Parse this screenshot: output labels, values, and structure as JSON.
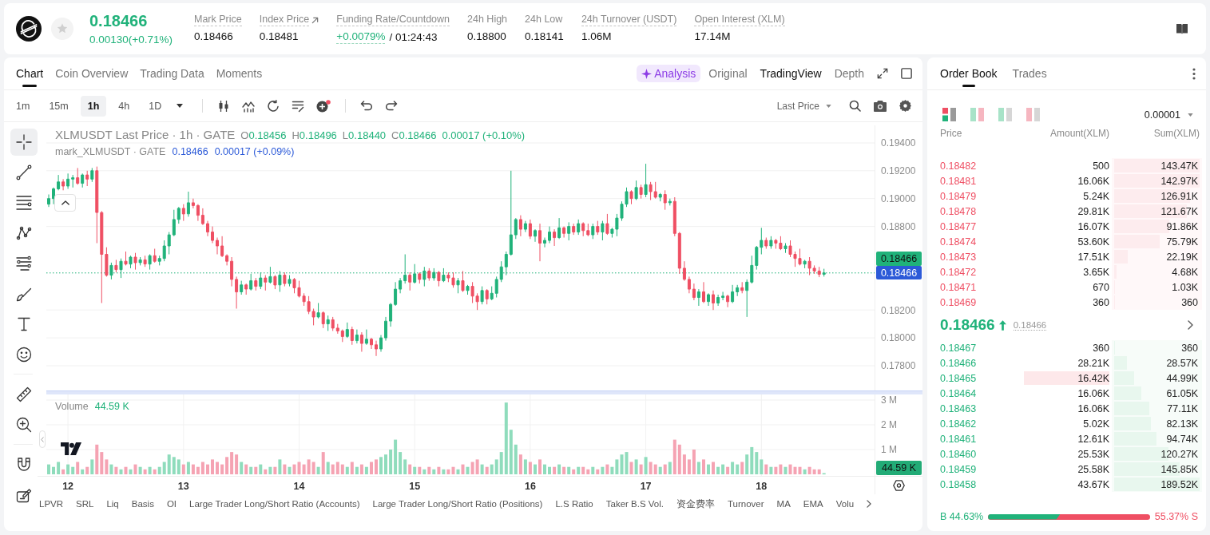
{
  "header": {
    "price": "0.18466",
    "change": "0.00130(+0.71%)",
    "stats": [
      {
        "kind": "plain",
        "label": "Mark Price",
        "value": "0.18466",
        "dotted": true
      },
      {
        "kind": "link",
        "label": "Index Price",
        "value": "0.18481",
        "dotted": true
      },
      {
        "kind": "funding",
        "label": "Funding Rate/Countdown",
        "value": "+0.0079%",
        "countdown": "/ 01:24:43",
        "dotted": true
      },
      {
        "kind": "plain",
        "label": "24h High",
        "value": "0.18800",
        "dotted": false
      },
      {
        "kind": "plain",
        "label": "24h Low",
        "value": "0.18141",
        "dotted": false
      },
      {
        "kind": "plain",
        "label": "24h Turnover (USDT)",
        "value": "1.06M",
        "dotted": true
      },
      {
        "kind": "plain",
        "label": "Open Interest (XLM)",
        "value": "17.14M",
        "dotted": true
      }
    ]
  },
  "chart_panel": {
    "tabs": [
      {
        "label": "Chart",
        "selected": true
      },
      {
        "label": "Coin Overview",
        "selected": false
      },
      {
        "label": "Trading Data",
        "selected": false
      },
      {
        "label": "Moments",
        "selected": false
      }
    ],
    "analysis": "Analysis",
    "views": [
      {
        "label": "Original",
        "selected": false
      },
      {
        "label": "TradingView",
        "selected": true
      },
      {
        "label": "Depth",
        "selected": false
      }
    ],
    "intervals": [
      {
        "label": "1m",
        "selected": false
      },
      {
        "label": "15m",
        "selected": false
      },
      {
        "label": "1h",
        "selected": true
      },
      {
        "label": "4h",
        "selected": false
      },
      {
        "label": "1D",
        "selected": false
      }
    ],
    "price_source": "Last Price",
    "tool_groups": [
      [
        {
          "kind": "crosshair",
          "selected": true
        },
        {
          "kind": "trend_line",
          "selected": false
        },
        {
          "kind": "fib_lines",
          "selected": false
        },
        {
          "kind": "pattern",
          "selected": false
        },
        {
          "kind": "parallel_lines",
          "selected": false
        },
        {
          "kind": "brush",
          "selected": false
        },
        {
          "kind": "text",
          "selected": false
        },
        {
          "kind": "emoji",
          "selected": false
        }
      ],
      [
        {
          "kind": "ruler",
          "selected": false
        },
        {
          "kind": "zoom",
          "selected": false
        }
      ],
      [
        {
          "kind": "magnet",
          "selected": false
        },
        {
          "kind": "drawing_edit",
          "selected": false
        }
      ]
    ],
    "legend": {
      "title": "XLMUSDT Last Price · 1h · GATE",
      "ohlc": [
        {
          "key": "O",
          "value": "0.18456"
        },
        {
          "key": "H",
          "value": "0.18496"
        },
        {
          "key": "L",
          "value": "0.18440"
        },
        {
          "key": "C",
          "value": "0.18466"
        }
      ],
      "change": "0.00017 (+0.10%)"
    },
    "mark_legend": {
      "title": "mark_XLMUSDT · GATE",
      "value": "0.18466",
      "change": "0.00017 (+0.09%)"
    },
    "chart_data": {
      "type": "candlestick",
      "grid": true,
      "categories": [
        null,
        null,
        null,
        null,
        null,
        null,
        null,
        null,
        null,
        null,
        null,
        null,
        null,
        null,
        null,
        null,
        null,
        null,
        null,
        null,
        null,
        null,
        null,
        null,
        null,
        null,
        null,
        null,
        null,
        null,
        null,
        null,
        null,
        null,
        null,
        null,
        null,
        null,
        null,
        null,
        null,
        null,
        null,
        null,
        null,
        null,
        null,
        null,
        null,
        null,
        null,
        null,
        null,
        null,
        null,
        null,
        null,
        null,
        null,
        null,
        null,
        null,
        null,
        null,
        null,
        null,
        null,
        null,
        null,
        null,
        null,
        null,
        null,
        null,
        null,
        null,
        null,
        null,
        null,
        null,
        null,
        null,
        null,
        null,
        null,
        null,
        null,
        null,
        null,
        null,
        null,
        null,
        null,
        null,
        null,
        null,
        null,
        null,
        null,
        null,
        null,
        null,
        null,
        null,
        null,
        null,
        null,
        null,
        null,
        null,
        null,
        null,
        null,
        null,
        null,
        null,
        null,
        null,
        null,
        null,
        null,
        null,
        null,
        null,
        null,
        null,
        null,
        null,
        null,
        null,
        null,
        null,
        null,
        null,
        null,
        null,
        null,
        null,
        null,
        null,
        null,
        null,
        null,
        null,
        null,
        null,
        null,
        null,
        null,
        null,
        null,
        null,
        null,
        null,
        null,
        null,
        null,
        null,
        null,
        null,
        null,
        null,
        null,
        null,
        null,
        null,
        null,
        null,
        null,
        null,
        null,
        null
      ],
      "ohlc": [
        [
          0.1896,
          0.1903,
          0.1894,
          0.19
        ],
        [
          0.19,
          0.1908,
          0.1896,
          0.1907
        ],
        [
          0.1907,
          0.1917,
          0.1906,
          0.1912
        ],
        [
          0.1912,
          0.1914,
          0.1906,
          0.1909
        ],
        [
          0.1909,
          0.1918,
          0.1907,
          0.1914
        ],
        [
          0.1914,
          0.1917,
          0.1908,
          0.1915
        ],
        [
          0.1915,
          0.1922,
          0.191,
          0.1911
        ],
        [
          0.1911,
          0.1918,
          0.1908,
          0.1917
        ],
        [
          0.1917,
          0.192,
          0.1909,
          0.1914
        ],
        [
          0.1914,
          0.1922,
          0.1912,
          0.192
        ],
        [
          0.192,
          0.1923,
          0.1868,
          0.189
        ],
        [
          0.189,
          0.1891,
          0.1825,
          0.186
        ],
        [
          0.186,
          0.1865,
          0.1844,
          0.1845
        ],
        [
          0.1845,
          0.1854,
          0.1842,
          0.1852
        ],
        [
          0.1852,
          0.1856,
          0.1847,
          0.1849
        ],
        [
          0.1849,
          0.1857,
          0.1843,
          0.1855
        ],
        [
          0.1855,
          0.1862,
          0.1852,
          0.1853
        ],
        [
          0.1853,
          0.1859,
          0.185,
          0.1858
        ],
        [
          0.1858,
          0.1861,
          0.1849,
          0.1854
        ],
        [
          0.1854,
          0.1858,
          0.1852,
          0.1856
        ],
        [
          0.1856,
          0.1859,
          0.1851,
          0.1853
        ],
        [
          0.1853,
          0.186,
          0.1849,
          0.1859
        ],
        [
          0.1859,
          0.1864,
          0.1854,
          0.1855
        ],
        [
          0.1855,
          0.1859,
          0.1852,
          0.1857
        ],
        [
          0.1857,
          0.187,
          0.1855,
          0.1866
        ],
        [
          0.1866,
          0.1876,
          0.186,
          0.1874
        ],
        [
          0.1874,
          0.1892,
          0.1873,
          0.1885
        ],
        [
          0.1885,
          0.1894,
          0.1882,
          0.1893
        ],
        [
          0.1893,
          0.1896,
          0.1884,
          0.1889
        ],
        [
          0.1889,
          0.1905,
          0.1887,
          0.1897
        ],
        [
          0.1897,
          0.19,
          0.1893,
          0.1895
        ],
        [
          0.1895,
          0.1896,
          0.1884,
          0.1888
        ],
        [
          0.1888,
          0.1893,
          0.1881,
          0.1882
        ],
        [
          0.1882,
          0.1884,
          0.1873,
          0.1876
        ],
        [
          0.1876,
          0.188,
          0.1868,
          0.187
        ],
        [
          0.187,
          0.1872,
          0.186,
          0.1866
        ],
        [
          0.1866,
          0.1873,
          0.1858,
          0.1859
        ],
        [
          0.1859,
          0.186,
          0.1852,
          0.1855
        ],
        [
          0.1855,
          0.1858,
          0.1837,
          0.1842
        ],
        [
          0.1842,
          0.1844,
          0.1821,
          0.1833
        ],
        [
          0.1833,
          0.1841,
          0.1831,
          0.1838
        ],
        [
          0.1838,
          0.1839,
          0.1831,
          0.1835
        ],
        [
          0.1835,
          0.1846,
          0.1834,
          0.1841
        ],
        [
          0.1841,
          0.1843,
          0.1834,
          0.1837
        ],
        [
          0.1837,
          0.1847,
          0.1835,
          0.1843
        ],
        [
          0.1843,
          0.1845,
          0.1834,
          0.184
        ],
        [
          0.184,
          0.1851,
          0.1839,
          0.1844
        ],
        [
          0.1844,
          0.1845,
          0.1835,
          0.1838
        ],
        [
          0.1838,
          0.1848,
          0.1833,
          0.1845
        ],
        [
          0.1845,
          0.1847,
          0.1837,
          0.1839
        ],
        [
          0.1839,
          0.1845,
          0.1837,
          0.1842
        ],
        [
          0.1842,
          0.1843,
          0.1832,
          0.1836
        ],
        [
          0.1836,
          0.1841,
          0.1829,
          0.183
        ],
        [
          0.183,
          0.1832,
          0.1823,
          0.1826
        ],
        [
          0.1826,
          0.183,
          0.1817,
          0.1819
        ],
        [
          0.1819,
          0.1821,
          0.1809,
          0.1815
        ],
        [
          0.1815,
          0.1825,
          0.1814,
          0.1818
        ],
        [
          0.1818,
          0.1819,
          0.1807,
          0.181
        ],
        [
          0.181,
          0.1816,
          0.1805,
          0.1813
        ],
        [
          0.1813,
          0.1815,
          0.1805,
          0.1807
        ],
        [
          0.1807,
          0.181,
          0.1803,
          0.1805
        ],
        [
          0.1805,
          0.1806,
          0.1797,
          0.1801
        ],
        [
          0.1801,
          0.1811,
          0.18,
          0.1806
        ],
        [
          0.1806,
          0.1808,
          0.1795,
          0.1798
        ],
        [
          0.1798,
          0.1806,
          0.1796,
          0.1802
        ],
        [
          0.1802,
          0.1804,
          0.179,
          0.1796
        ],
        [
          0.1796,
          0.1806,
          0.1795,
          0.1799
        ],
        [
          0.1799,
          0.18,
          0.1792,
          0.1795
        ],
        [
          0.1795,
          0.1798,
          0.1787,
          0.1792
        ],
        [
          0.1792,
          0.1802,
          0.179,
          0.18
        ],
        [
          0.18,
          0.1815,
          0.1798,
          0.1812
        ],
        [
          0.1812,
          0.1825,
          0.1808,
          0.1824
        ],
        [
          0.1824,
          0.184,
          0.1823,
          0.1835
        ],
        [
          0.1835,
          0.1843,
          0.1832,
          0.1841
        ],
        [
          0.1841,
          0.186,
          0.1839,
          0.1845
        ],
        [
          0.1845,
          0.1847,
          0.1834,
          0.184
        ],
        [
          0.184,
          0.1853,
          0.1839,
          0.1846
        ],
        [
          0.1846,
          0.1847,
          0.1839,
          0.1842
        ],
        [
          0.1842,
          0.1851,
          0.1837,
          0.1848
        ],
        [
          0.1848,
          0.185,
          0.1841,
          0.1843
        ],
        [
          0.1843,
          0.185,
          0.1841,
          0.1847
        ],
        [
          0.1847,
          0.1848,
          0.1837,
          0.1841
        ],
        [
          0.1841,
          0.185,
          0.184,
          0.1845
        ],
        [
          0.1845,
          0.1847,
          0.184,
          0.1843
        ],
        [
          0.1843,
          0.1847,
          0.1836,
          0.1838
        ],
        [
          0.1838,
          0.1843,
          0.1832,
          0.1841
        ],
        [
          0.1841,
          0.1848,
          0.1833,
          0.1834
        ],
        [
          0.1834,
          0.1838,
          0.1831,
          0.1837
        ],
        [
          0.1837,
          0.184,
          0.1825,
          0.183
        ],
        [
          0.183,
          0.1832,
          0.182,
          0.1826
        ],
        [
          0.1826,
          0.1837,
          0.1824,
          0.1834
        ],
        [
          0.1834,
          0.1835,
          0.1824,
          0.1828
        ],
        [
          0.1828,
          0.1837,
          0.1827,
          0.1832
        ],
        [
          0.1832,
          0.1844,
          0.1829,
          0.1842
        ],
        [
          0.1842,
          0.1855,
          0.184,
          0.1851
        ],
        [
          0.1851,
          0.1862,
          0.1845,
          0.186
        ],
        [
          0.186,
          0.192,
          0.1859,
          0.1874
        ],
        [
          0.1874,
          0.1886,
          0.1871,
          0.1885
        ],
        [
          0.1885,
          0.1888,
          0.1873,
          0.1878
        ],
        [
          0.1878,
          0.1884,
          0.1876,
          0.1882
        ],
        [
          0.1882,
          0.1885,
          0.1871,
          0.1873
        ],
        [
          0.1873,
          0.1878,
          0.1869,
          0.1877
        ],
        [
          0.1877,
          0.1882,
          0.1855,
          0.1868
        ],
        [
          0.1868,
          0.1872,
          0.1865,
          0.187
        ],
        [
          0.187,
          0.188,
          0.1868,
          0.1876
        ],
        [
          0.1876,
          0.1878,
          0.1866,
          0.1872
        ],
        [
          0.1872,
          0.1886,
          0.1871,
          0.1879
        ],
        [
          0.1879,
          0.188,
          0.1872,
          0.1875
        ],
        [
          0.1875,
          0.1883,
          0.187,
          0.188
        ],
        [
          0.188,
          0.1882,
          0.1874,
          0.1876
        ],
        [
          0.1876,
          0.1885,
          0.1874,
          0.1882
        ],
        [
          0.1882,
          0.1883,
          0.1873,
          0.1877
        ],
        [
          0.1877,
          0.1882,
          0.1873,
          0.1874
        ],
        [
          0.1874,
          0.1882,
          0.1871,
          0.188
        ],
        [
          0.188,
          0.1884,
          0.1874,
          0.1876
        ],
        [
          0.1876,
          0.1884,
          0.187,
          0.1882
        ],
        [
          0.1882,
          0.1889,
          0.1874,
          0.1875
        ],
        [
          0.1875,
          0.1879,
          0.1872,
          0.1878
        ],
        [
          0.1878,
          0.1889,
          0.1873,
          0.1886
        ],
        [
          0.1886,
          0.1898,
          0.1884,
          0.1896
        ],
        [
          0.1896,
          0.1908,
          0.1894,
          0.1905
        ],
        [
          0.1905,
          0.1906,
          0.1896,
          0.19
        ],
        [
          0.19,
          0.1913,
          0.1899,
          0.1908
        ],
        [
          0.1908,
          0.191,
          0.19,
          0.1903
        ],
        [
          0.1903,
          0.1925,
          0.1901,
          0.191
        ],
        [
          0.191,
          0.1912,
          0.1899,
          0.1905
        ],
        [
          0.1905,
          0.1912,
          0.19,
          0.1901
        ],
        [
          0.1901,
          0.1904,
          0.1898,
          0.1903
        ],
        [
          0.1903,
          0.1906,
          0.1892,
          0.1897
        ],
        [
          0.1897,
          0.19,
          0.1895,
          0.1898
        ],
        [
          0.1898,
          0.1901,
          0.1873,
          0.1875
        ],
        [
          0.1875,
          0.1876,
          0.1846,
          0.185
        ],
        [
          0.185,
          0.1855,
          0.1841,
          0.1842
        ],
        [
          0.1842,
          0.1844,
          0.1832,
          0.1835
        ],
        [
          0.1835,
          0.1839,
          0.1827,
          0.1829
        ],
        [
          0.1829,
          0.1835,
          0.1823,
          0.1833
        ],
        [
          0.1833,
          0.184,
          0.1825,
          0.1826
        ],
        [
          0.1826,
          0.1832,
          0.1823,
          0.1831
        ],
        [
          0.1831,
          0.1834,
          0.182,
          0.1825
        ],
        [
          0.1825,
          0.1831,
          0.1823,
          0.1829
        ],
        [
          0.1829,
          0.1833,
          0.1827,
          0.183
        ],
        [
          0.183,
          0.1831,
          0.1822,
          0.1826
        ],
        [
          0.1826,
          0.1838,
          0.1825,
          0.1833
        ],
        [
          0.1833,
          0.1838,
          0.183,
          0.1836
        ],
        [
          0.1836,
          0.184,
          0.1832,
          0.1834
        ],
        [
          0.1834,
          0.1842,
          0.1815,
          0.184
        ],
        [
          0.184,
          0.1859,
          0.1839,
          0.1852
        ],
        [
          0.1852,
          0.1866,
          0.1849,
          0.1865
        ],
        [
          0.1865,
          0.1879,
          0.186,
          0.187
        ],
        [
          0.187,
          0.1872,
          0.1864,
          0.1866
        ],
        [
          0.1866,
          0.1873,
          0.1864,
          0.187
        ],
        [
          0.187,
          0.1871,
          0.1864,
          0.1868
        ],
        [
          0.1868,
          0.1873,
          0.1863,
          0.1864
        ],
        [
          0.1864,
          0.1868,
          0.1861,
          0.1866
        ],
        [
          0.1866,
          0.187,
          0.1858,
          0.186
        ],
        [
          0.186,
          0.1862,
          0.1851,
          0.1857
        ],
        [
          0.1857,
          0.1864,
          0.1852,
          0.1853
        ],
        [
          0.1853,
          0.1856,
          0.185,
          0.1855
        ],
        [
          0.1855,
          0.1858,
          0.1845,
          0.185
        ],
        [
          0.185,
          0.1852,
          0.1846,
          0.1848
        ],
        [
          0.1848,
          0.1851,
          0.18436,
          0.18456
        ],
        [
          0.18456,
          0.18496,
          0.1844,
          0.18466
        ],
        null,
        null,
        null,
        null,
        null,
        null,
        null,
        null,
        null,
        null
      ],
      "ref_lines": [
        {
          "axis": "y",
          "value": 0.18466,
          "label": "0.18466",
          "color": "#20b27a"
        }
      ],
      "ylim": [
        0.17622,
        0.19526
      ],
      "yticks": [
        {
          "value": 0.194,
          "label": "0.19400"
        },
        {
          "value": 0.192,
          "label": "0.19200"
        },
        {
          "value": 0.19,
          "label": "0.19000"
        },
        {
          "value": 0.188,
          "label": "0.18800"
        },
        {
          "value": 0.182,
          "label": "0.18200"
        },
        {
          "value": 0.18,
          "label": "0.18000"
        },
        {
          "value": 0.178,
          "label": "0.17800"
        }
      ]
    },
    "mark_price_tag": "0.18466",
    "volume": {
      "label": "Volume",
      "value": "44.59 K",
      "tag": "44.59 K",
      "chart_data": {
        "type": "bar",
        "grid": true,
        "categories": [
          null,
          null,
          null,
          null,
          "12",
          null,
          null,
          null,
          null,
          null,
          null,
          null,
          null,
          null,
          null,
          null,
          null,
          null,
          null,
          null,
          null,
          null,
          null,
          null,
          null,
          null,
          null,
          null,
          "13",
          null,
          null,
          null,
          null,
          null,
          null,
          null,
          null,
          null,
          null,
          null,
          null,
          null,
          null,
          null,
          null,
          null,
          null,
          null,
          null,
          null,
          null,
          null,
          "14",
          null,
          null,
          null,
          null,
          null,
          null,
          null,
          null,
          null,
          null,
          null,
          null,
          null,
          null,
          null,
          null,
          null,
          null,
          null,
          null,
          null,
          null,
          null,
          "15",
          null,
          null,
          null,
          null,
          null,
          null,
          null,
          null,
          null,
          null,
          null,
          null,
          null,
          null,
          null,
          null,
          null,
          null,
          null,
          null,
          null,
          null,
          null,
          "16",
          null,
          null,
          null,
          null,
          null,
          null,
          null,
          null,
          null,
          null,
          null,
          null,
          null,
          null,
          null,
          null,
          null,
          null,
          null,
          null,
          null,
          null,
          null,
          "17",
          null,
          null,
          null,
          null,
          null,
          null,
          null,
          null,
          null,
          null,
          null,
          null,
          null,
          null,
          null,
          null,
          null,
          null,
          null,
          null,
          null,
          null,
          null,
          "18",
          null,
          null,
          null,
          null,
          null,
          null,
          null,
          null,
          null,
          null,
          null,
          null,
          null,
          null,
          null,
          null,
          null,
          null,
          null,
          null,
          null,
          null,
          null
        ],
        "values": [
          0.4,
          0.3,
          0.5,
          0.2,
          0.4,
          0.3,
          0.5,
          0.2,
          0.3,
          0.6,
          1.2,
          0.9,
          0.6,
          0.4,
          0.3,
          0.2,
          0.3,
          0.2,
          0.4,
          0.3,
          0.2,
          0.3,
          0.2,
          0.3,
          0.5,
          0.8,
          0.7,
          0.6,
          0.4,
          0.5,
          0.4,
          0.3,
          0.5,
          0.4,
          0.6,
          0.5,
          0.4,
          0.7,
          0.9,
          0.8,
          0.5,
          0.4,
          0.3,
          0.3,
          0.4,
          0.2,
          0.3,
          0.3,
          0.6,
          0.4,
          0.3,
          0.4,
          0.5,
          0.4,
          0.6,
          0.5,
          0.3,
          0.9,
          0.5,
          0.4,
          0.5,
          0.4,
          0.3,
          0.5,
          0.3,
          0.4,
          0.3,
          0.5,
          0.6,
          0.7,
          0.8,
          1.0,
          1.4,
          0.9,
          0.6,
          0.4,
          0.3,
          0.3,
          0.2,
          0.3,
          0.2,
          0.3,
          0.2,
          0.2,
          0.3,
          0.2,
          0.4,
          0.3,
          0.5,
          0.6,
          0.4,
          0.3,
          0.4,
          0.6,
          0.9,
          2.9,
          1.8,
          1.2,
          0.8,
          0.6,
          0.5,
          0.4,
          0.6,
          0.4,
          0.3,
          0.3,
          0.4,
          0.3,
          0.3,
          0.2,
          0.3,
          0.3,
          0.2,
          0.3,
          0.2,
          0.3,
          0.4,
          0.3,
          0.6,
          0.8,
          0.9,
          0.5,
          0.6,
          0.4,
          0.7,
          0.5,
          0.4,
          0.3,
          0.4,
          0.5,
          1.4,
          1.2,
          0.8,
          0.6,
          1.0,
          0.5,
          0.6,
          0.4,
          0.5,
          0.3,
          0.4,
          0.3,
          0.5,
          0.4,
          0.5,
          0.8,
          1.1,
          0.9,
          0.6,
          0.4,
          0.3,
          0.3,
          0.4,
          0.3,
          0.4,
          0.3,
          0.3,
          0.2,
          0.3,
          0.2,
          0.2,
          0.05,
          null,
          null,
          null,
          null,
          null,
          null,
          null,
          null,
          null,
          null
        ],
        "ylim": [
          -0.0645,
          3.2258
        ],
        "yticks": [
          {
            "value": 3,
            "label": "3 M"
          },
          {
            "value": 2,
            "label": "2 M"
          },
          {
            "value": 1,
            "label": "1 M"
          }
        ]
      }
    },
    "indicators": [
      "LPVR",
      "SRL",
      "Liq",
      "Basis",
      "OI",
      "Large Trader Long/Short Ratio (Accounts)",
      "Large Trader Long/Short Ratio (Positions)",
      "L.S Ratio",
      "Taker B.S Vol.",
      "资金费率",
      "Turnover",
      "MA",
      "EMA",
      "Volu"
    ]
  },
  "order_book": {
    "tabs": [
      {
        "label": "Order Book",
        "selected": true
      },
      {
        "label": "Trades",
        "selected": false
      }
    ],
    "views": [
      {
        "kind": "both",
        "selected": true
      },
      {
        "kind": "split",
        "selected": false
      },
      {
        "kind": "bids",
        "selected": false
      },
      {
        "kind": "asks",
        "selected": false
      }
    ],
    "precision": "0.00001",
    "columns": [
      "Price",
      "Amount(XLM)",
      "Sum(XLM)"
    ],
    "asks": [
      {
        "price": "0.18482",
        "amount": "500",
        "sum": "143.47K",
        "level": 1,
        "highlight": false
      },
      {
        "price": "0.18481",
        "amount": "16.06K",
        "sum": "142.97K",
        "level": 0.9965,
        "highlight": false
      },
      {
        "price": "0.18479",
        "amount": "5.24K",
        "sum": "126.91K",
        "level": 0.8846,
        "highlight": false
      },
      {
        "price": "0.18478",
        "amount": "29.81K",
        "sum": "121.67K",
        "level": 0.848,
        "highlight": false
      },
      {
        "price": "0.18477",
        "amount": "16.07K",
        "sum": "91.86K",
        "level": 0.6403,
        "highlight": false
      },
      {
        "price": "0.18474",
        "amount": "53.60K",
        "sum": "75.79K",
        "level": 0.5283,
        "highlight": false
      },
      {
        "price": "0.18473",
        "amount": "17.51K",
        "sum": "22.19K",
        "level": 0.1547,
        "highlight": false
      },
      {
        "price": "0.18472",
        "amount": "3.65K",
        "sum": "4.68K",
        "level": 0.0326,
        "highlight": false
      },
      {
        "price": "0.18471",
        "amount": "670",
        "sum": "1.03K",
        "level": 0.0072,
        "highlight": false
      },
      {
        "price": "0.18469",
        "amount": "360",
        "sum": "360",
        "level": 0.0025,
        "highlight": false
      }
    ],
    "last_price": "0.18466",
    "rising": true,
    "mark_price": "0.18466",
    "bids": [
      {
        "price": "0.18467",
        "amount": "360",
        "sum": "360",
        "level": 0.0019,
        "highlight": false
      },
      {
        "price": "0.18466",
        "amount": "28.21K",
        "sum": "28.57K",
        "level": 0.1508,
        "highlight": false
      },
      {
        "price": "0.18465",
        "amount": "16.42K",
        "sum": "44.99K",
        "level": 0.2374,
        "highlight": true
      },
      {
        "price": "0.18464",
        "amount": "16.06K",
        "sum": "61.05K",
        "level": 0.3221,
        "highlight": false
      },
      {
        "price": "0.18463",
        "amount": "16.06K",
        "sum": "77.11K",
        "level": 0.4069,
        "highlight": false
      },
      {
        "price": "0.18462",
        "amount": "5.02K",
        "sum": "82.13K",
        "level": 0.4334,
        "highlight": false
      },
      {
        "price": "0.18461",
        "amount": "12.61K",
        "sum": "94.74K",
        "level": 0.4999,
        "highlight": false
      },
      {
        "price": "0.18460",
        "amount": "25.53K",
        "sum": "120.27K",
        "level": 0.6346,
        "highlight": false
      },
      {
        "price": "0.18459",
        "amount": "25.58K",
        "sum": "145.85K",
        "level": 0.7696,
        "highlight": false
      },
      {
        "price": "0.18458",
        "amount": "43.67K",
        "sum": "189.52K",
        "level": 1,
        "highlight": false
      }
    ],
    "ratio": {
      "buy": "B 44.63%",
      "sell": "55.37% S",
      "level": 0.4463
    }
  }
}
